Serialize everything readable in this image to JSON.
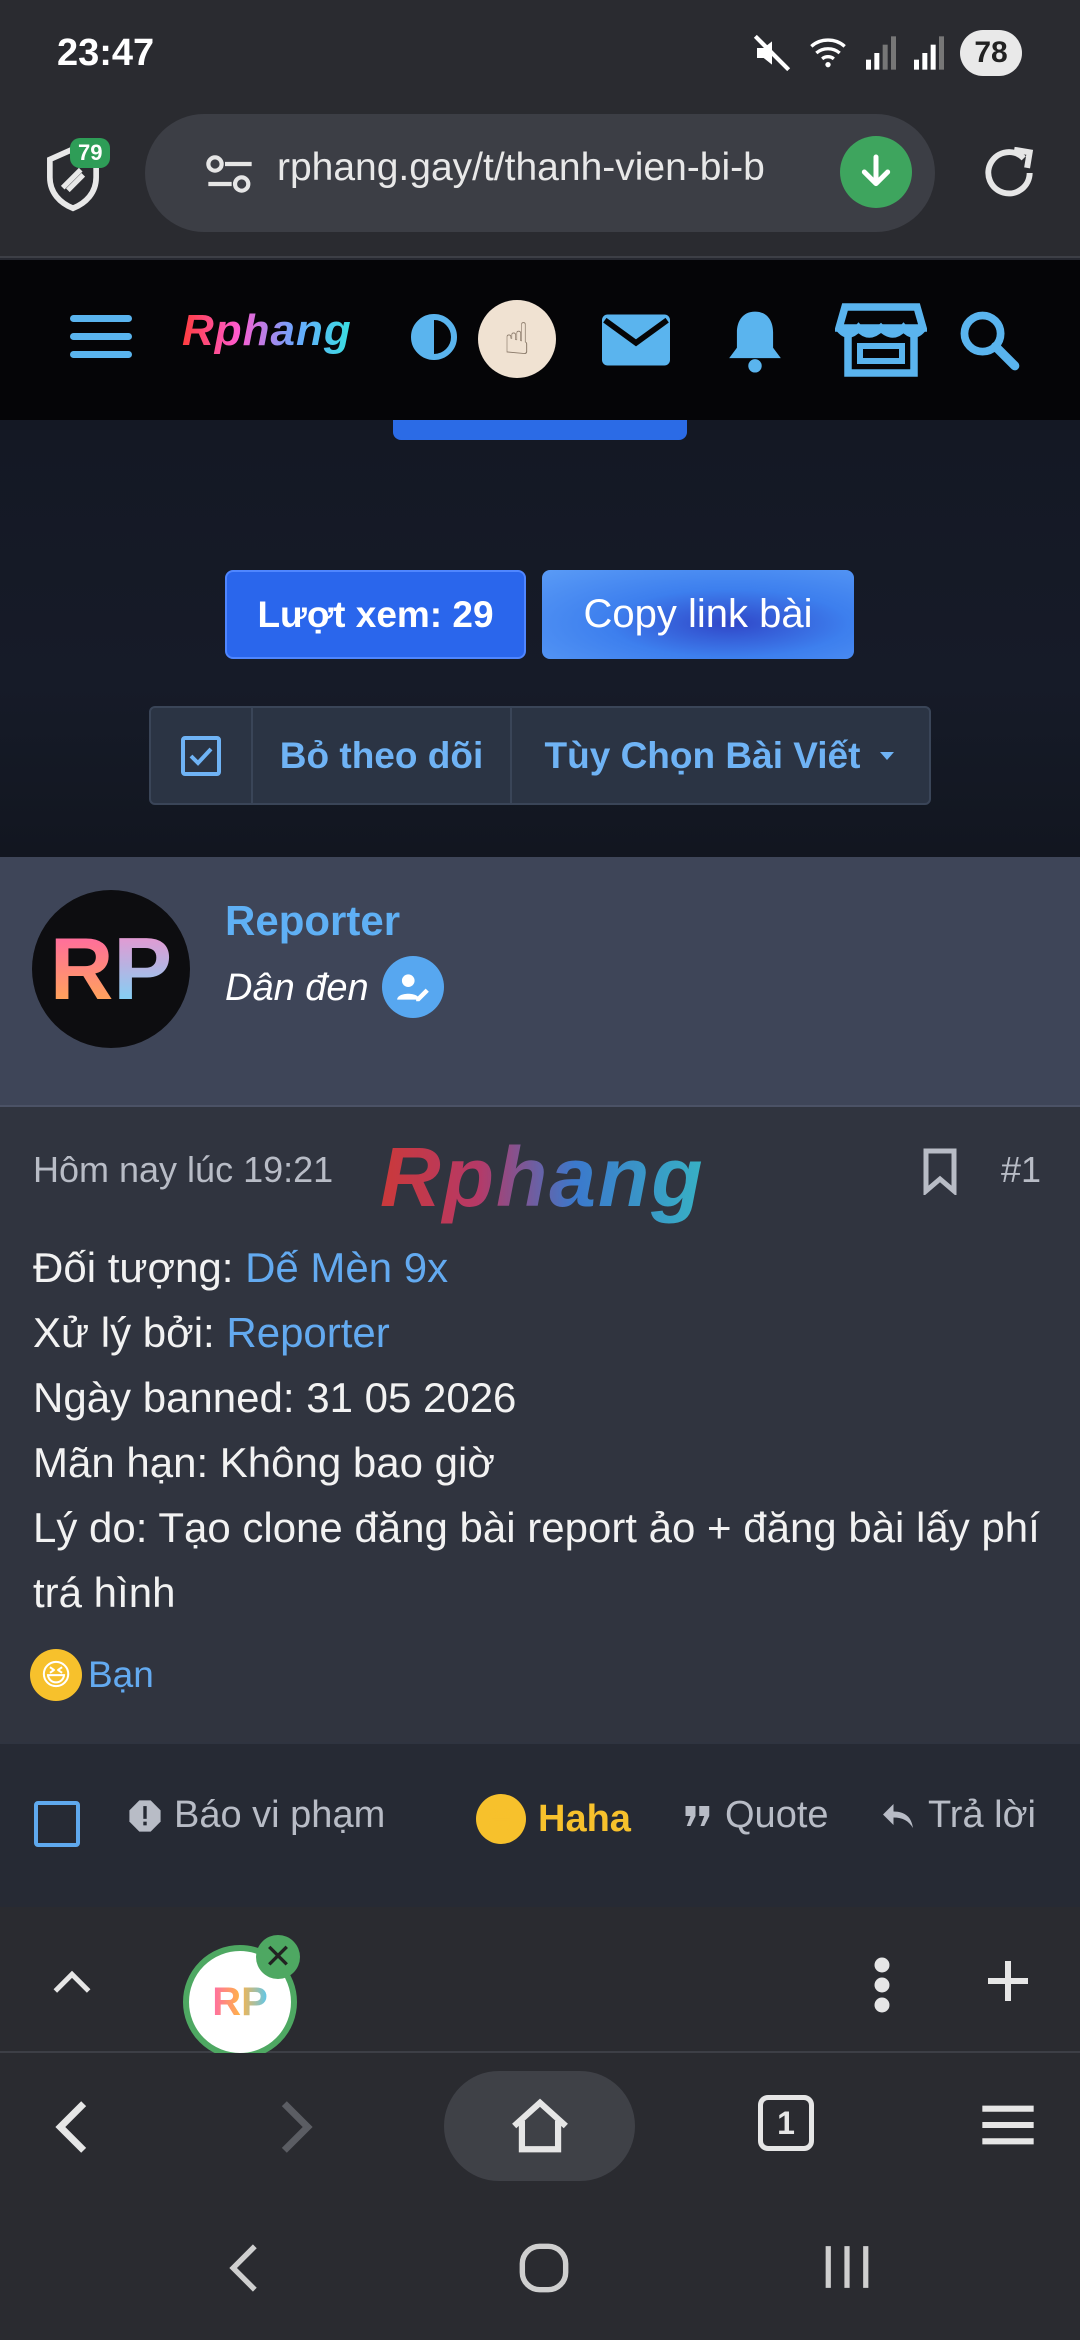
{
  "status_bar": {
    "time": "23:47",
    "battery": "78"
  },
  "browser": {
    "shield_badge": "79",
    "url": "rphang.gay/t/thanh-vien-bi-b"
  },
  "site_header": {
    "logo": "Rphang"
  },
  "thread": {
    "views_label": "Lượt xem: 29",
    "copy_label": "Copy link bài",
    "unwatch_label": "Bỏ theo dõi",
    "options_label": "Tùy Chọn Bài Viết"
  },
  "author": {
    "avatar_text_r": "R",
    "avatar_text_p": "P",
    "name": "Reporter",
    "title": "Dân đen"
  },
  "post": {
    "time": "Hôm nay lúc 19:21",
    "watermark": "Rphang",
    "number": "#1",
    "lines": {
      "target_label": "Đối tượng: ",
      "target_value": "Dế Mèn 9x",
      "handled_label": "Xử lý bởi: ",
      "handled_value": "Reporter",
      "banned_date": "Ngày banned: 31 05 2026",
      "expiry": "Mãn hạn: Không bao giờ",
      "reason": "Lý do: Tạo clone đăng bài report ảo + đăng bài lấy phí trá hình"
    },
    "reaction_user": "Bạn"
  },
  "actions": {
    "report": "Báo vi phạm",
    "haha": "Haha",
    "quote": "Quote",
    "reply": "Trả lời"
  },
  "tab_avatar": "RP",
  "tab_count": "1",
  "colors": {
    "accent": "#5fb0f5",
    "haha": "#f7c12c",
    "button": "#2a66ec"
  }
}
